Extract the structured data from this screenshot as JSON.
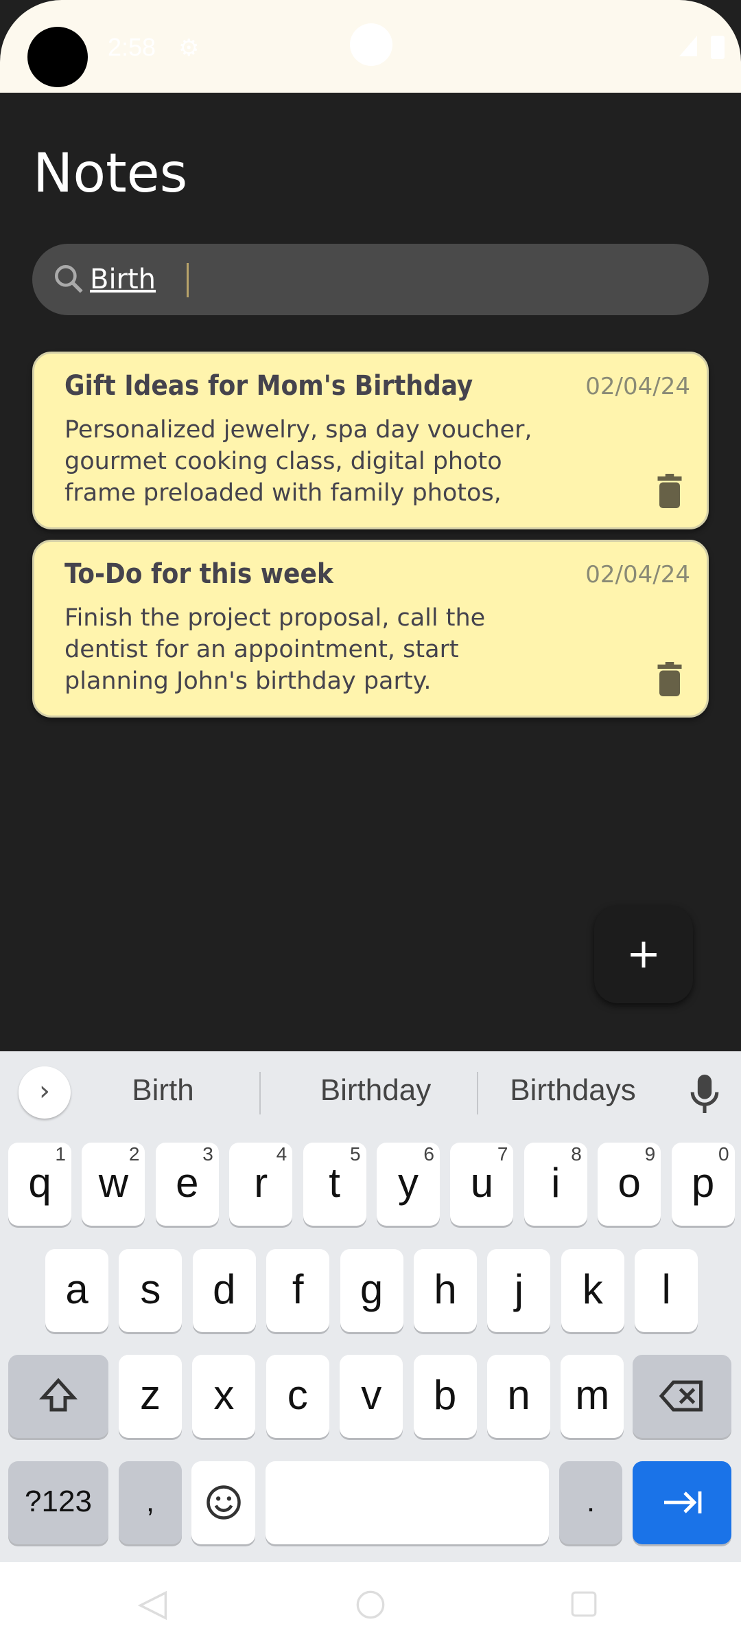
{
  "status_bar": {
    "time": "2:58",
    "icons": [
      "settings-gear-icon",
      "signal-icon",
      "battery-icon"
    ]
  },
  "header": {
    "title": "Notes"
  },
  "search": {
    "value": "Birth",
    "icon": "search-icon"
  },
  "notes": [
    {
      "title": "Gift Ideas for Mom's Birthday",
      "date": "02/04/24",
      "body": "Personalized jewelry, spa day voucher, gourmet cooking class, digital photo frame preloaded with family photos,"
    },
    {
      "title": "To-Do for this week",
      "date": "02/04/24",
      "body": "Finish the project proposal, call the dentist for an appointment, start planning John's birthday party."
    }
  ],
  "fab": {
    "label": "+"
  },
  "colors": {
    "card": "#fff4ad",
    "background": "#202020",
    "enter_key": "#1a73e8"
  },
  "keyboard": {
    "suggestions": [
      "Birth",
      "Birthday",
      "Birthdays"
    ],
    "row1": [
      [
        "q",
        "1"
      ],
      [
        "w",
        "2"
      ],
      [
        "e",
        "3"
      ],
      [
        "r",
        "4"
      ],
      [
        "t",
        "5"
      ],
      [
        "y",
        "6"
      ],
      [
        "u",
        "7"
      ],
      [
        "i",
        "8"
      ],
      [
        "o",
        "9"
      ],
      [
        "p",
        "0"
      ]
    ],
    "row2": [
      "a",
      "s",
      "d",
      "f",
      "g",
      "h",
      "j",
      "k",
      "l"
    ],
    "row3": [
      "z",
      "x",
      "c",
      "v",
      "b",
      "n",
      "m"
    ],
    "symbols_label": "?123",
    "comma": ",",
    "period": "."
  }
}
